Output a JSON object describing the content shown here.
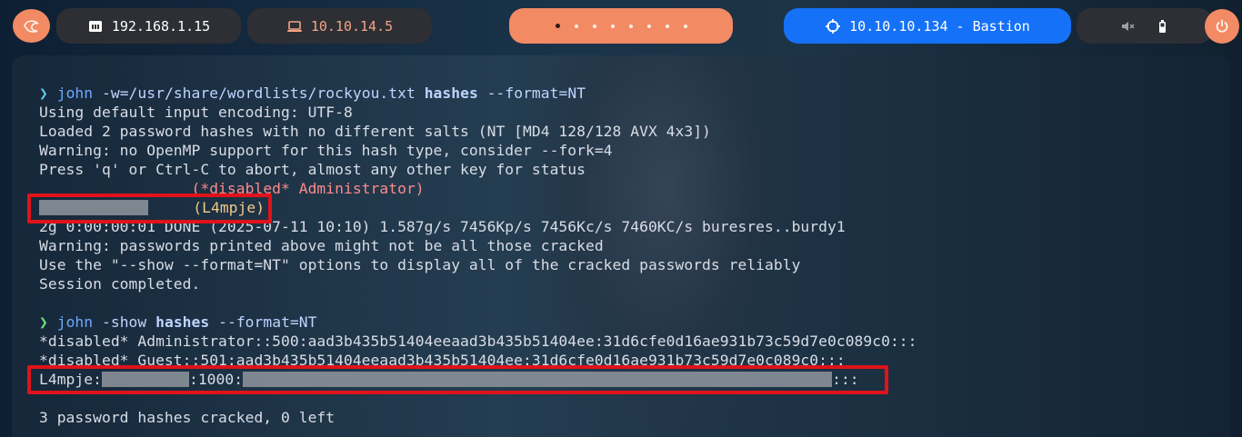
{
  "topbar": {
    "menu_icon": "kali-dragon-icon",
    "local_ip": "192.168.1.15",
    "local_icon": "ethernet-icon",
    "vpn_ip": "10.10.14.5",
    "vpn_icon": "laptop-icon",
    "workspaces": {
      "count": 8,
      "active_index": 0
    },
    "target_label": "10.10.10.134 - Bastion",
    "target_icon": "crosshair-icon",
    "status_icons": [
      "muted-speaker-icon",
      "battery-icon"
    ],
    "power_icon": "power-icon"
  },
  "colors": {
    "accent": "#f28a64",
    "target": "#1571f8",
    "pill_dark": "#2d2f35",
    "highlight_box": "#e0121a"
  },
  "terminal": {
    "cmd1": {
      "arrow": "❯",
      "program": "john",
      "args": "-w=/usr/share/wordlists/rockyou.txt",
      "file": "hashes",
      "format": "--format=NT"
    },
    "out1": [
      "Using default input encoding: UTF-8",
      "Loaded 2 password hashes with no different salts (NT [MD4 128/128 AVX 4x3])",
      "Warning: no OpenMP support for this hash type, consider --fork=4",
      "Press 'q' or Ctrl-C to abort, almost any other key for status"
    ],
    "crack_admin": "(*disabled* Administrator)",
    "crack_l4mpje": "(L4mpje)",
    "out2": [
      "2g 0:00:00:01 DONE (2025-07-11 10:10) 1.587g/s 7456Kp/s 7456Kc/s 7460KC/s buresres..burdy1",
      "Warning: passwords printed above might not be all those cracked",
      "Use the \"--show --format=NT\" options to display all of the cracked passwords reliably",
      "Session completed."
    ],
    "cmd2": {
      "arrow": "❯",
      "program": "john",
      "args": "-show",
      "file": "hashes",
      "format": "--format=NT"
    },
    "show_admin": "*disabled* Administrator::500:aad3b435b51404eeaad3b435b51404ee:31d6cfe0d16ae931b73c59d7e0c089c0:::",
    "show_guest": "*disabled* Guest::501:aad3b435b51404eeaad3b435b51404ee:31d6cfe0d16ae931b73c59d7e0c089c0:::",
    "show_l4mpje_user": "L4mpje:",
    "show_l4mpje_mid": ":1000:",
    "show_l4mpje_end": ":::",
    "summary": "3 password hashes cracked, 0 left"
  }
}
